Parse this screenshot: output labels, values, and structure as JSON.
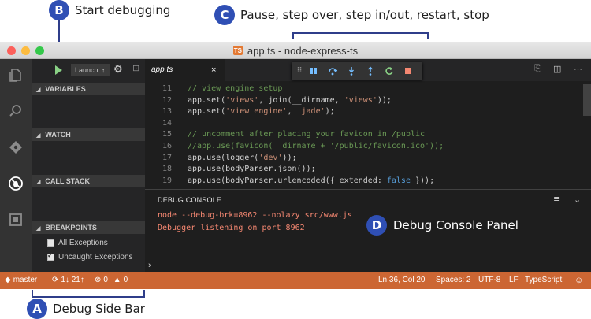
{
  "callouts": {
    "b": {
      "letter": "B",
      "text": "Start debugging"
    },
    "c": {
      "letter": "C",
      "text": "Pause, step over, step in/out, restart, stop"
    },
    "d": {
      "letter": "D",
      "text": "Debug Console Panel"
    },
    "a": {
      "letter": "A",
      "text": "Debug Side Bar"
    }
  },
  "window": {
    "title": "app.ts - node-express-ts"
  },
  "debug_toolbar": {
    "config": "Launch",
    "config_caret": "↕"
  },
  "sidebar": {
    "sections": {
      "variables": "VARIABLES",
      "watch": "WATCH",
      "call_stack": "CALL STACK",
      "breakpoints": "BREAKPOINTS"
    },
    "breakpoints": [
      {
        "label": "All Exceptions",
        "checked": false
      },
      {
        "label": "Uncaught Exceptions",
        "checked": true
      }
    ]
  },
  "editor": {
    "tab_label": "app.ts",
    "tab_close": "×",
    "lines": [
      {
        "num": "11",
        "tokens": [
          {
            "t": "// view engine setup",
            "c": "cm"
          }
        ]
      },
      {
        "num": "12",
        "tokens": [
          {
            "t": "app.set(",
            "c": ""
          },
          {
            "t": "'views'",
            "c": "str"
          },
          {
            "t": ", join(__dirname, ",
            "c": ""
          },
          {
            "t": "'views'",
            "c": "str"
          },
          {
            "t": "));",
            "c": ""
          }
        ]
      },
      {
        "num": "13",
        "tokens": [
          {
            "t": "app.set(",
            "c": ""
          },
          {
            "t": "'view engine'",
            "c": "str"
          },
          {
            "t": ", ",
            "c": ""
          },
          {
            "t": "'jade'",
            "c": "str"
          },
          {
            "t": ");",
            "c": ""
          }
        ]
      },
      {
        "num": "14",
        "tokens": []
      },
      {
        "num": "15",
        "tokens": [
          {
            "t": "// uncomment after placing your favicon in /public",
            "c": "cm"
          }
        ]
      },
      {
        "num": "16",
        "tokens": [
          {
            "t": "//app.use(favicon(__dirname + '/public/favicon.ico'));",
            "c": "cm"
          }
        ]
      },
      {
        "num": "17",
        "tokens": [
          {
            "t": "app.use(logger(",
            "c": ""
          },
          {
            "t": "'dev'",
            "c": "str"
          },
          {
            "t": "));",
            "c": ""
          }
        ]
      },
      {
        "num": "18",
        "tokens": [
          {
            "t": "app.use(bodyParser.json());",
            "c": ""
          }
        ]
      },
      {
        "num": "19",
        "tokens": [
          {
            "t": "app.use(bodyParser.urlencoded({ extended: ",
            "c": ""
          },
          {
            "t": "false",
            "c": "kw"
          },
          {
            "t": " }));",
            "c": ""
          }
        ]
      }
    ]
  },
  "debug_console": {
    "title": "DEBUG CONSOLE",
    "lines": [
      "node --debug-brk=8962 --nolazy src/www.js",
      "Debugger listening on port 8962"
    ],
    "prompt": "›"
  },
  "status_bar": {
    "branch": "master",
    "sync": "1↓ 21↑",
    "errors": "0",
    "warnings": "0",
    "position": "Ln 36, Col 20",
    "spaces": "Spaces: 2",
    "encoding": "UTF-8",
    "eol": "LF",
    "language": "TypeScript"
  },
  "colors": {
    "status_bar": "#cc6633",
    "callout_badge": "#2f4fb4",
    "play": "#89d185",
    "stop": "#f48771"
  }
}
